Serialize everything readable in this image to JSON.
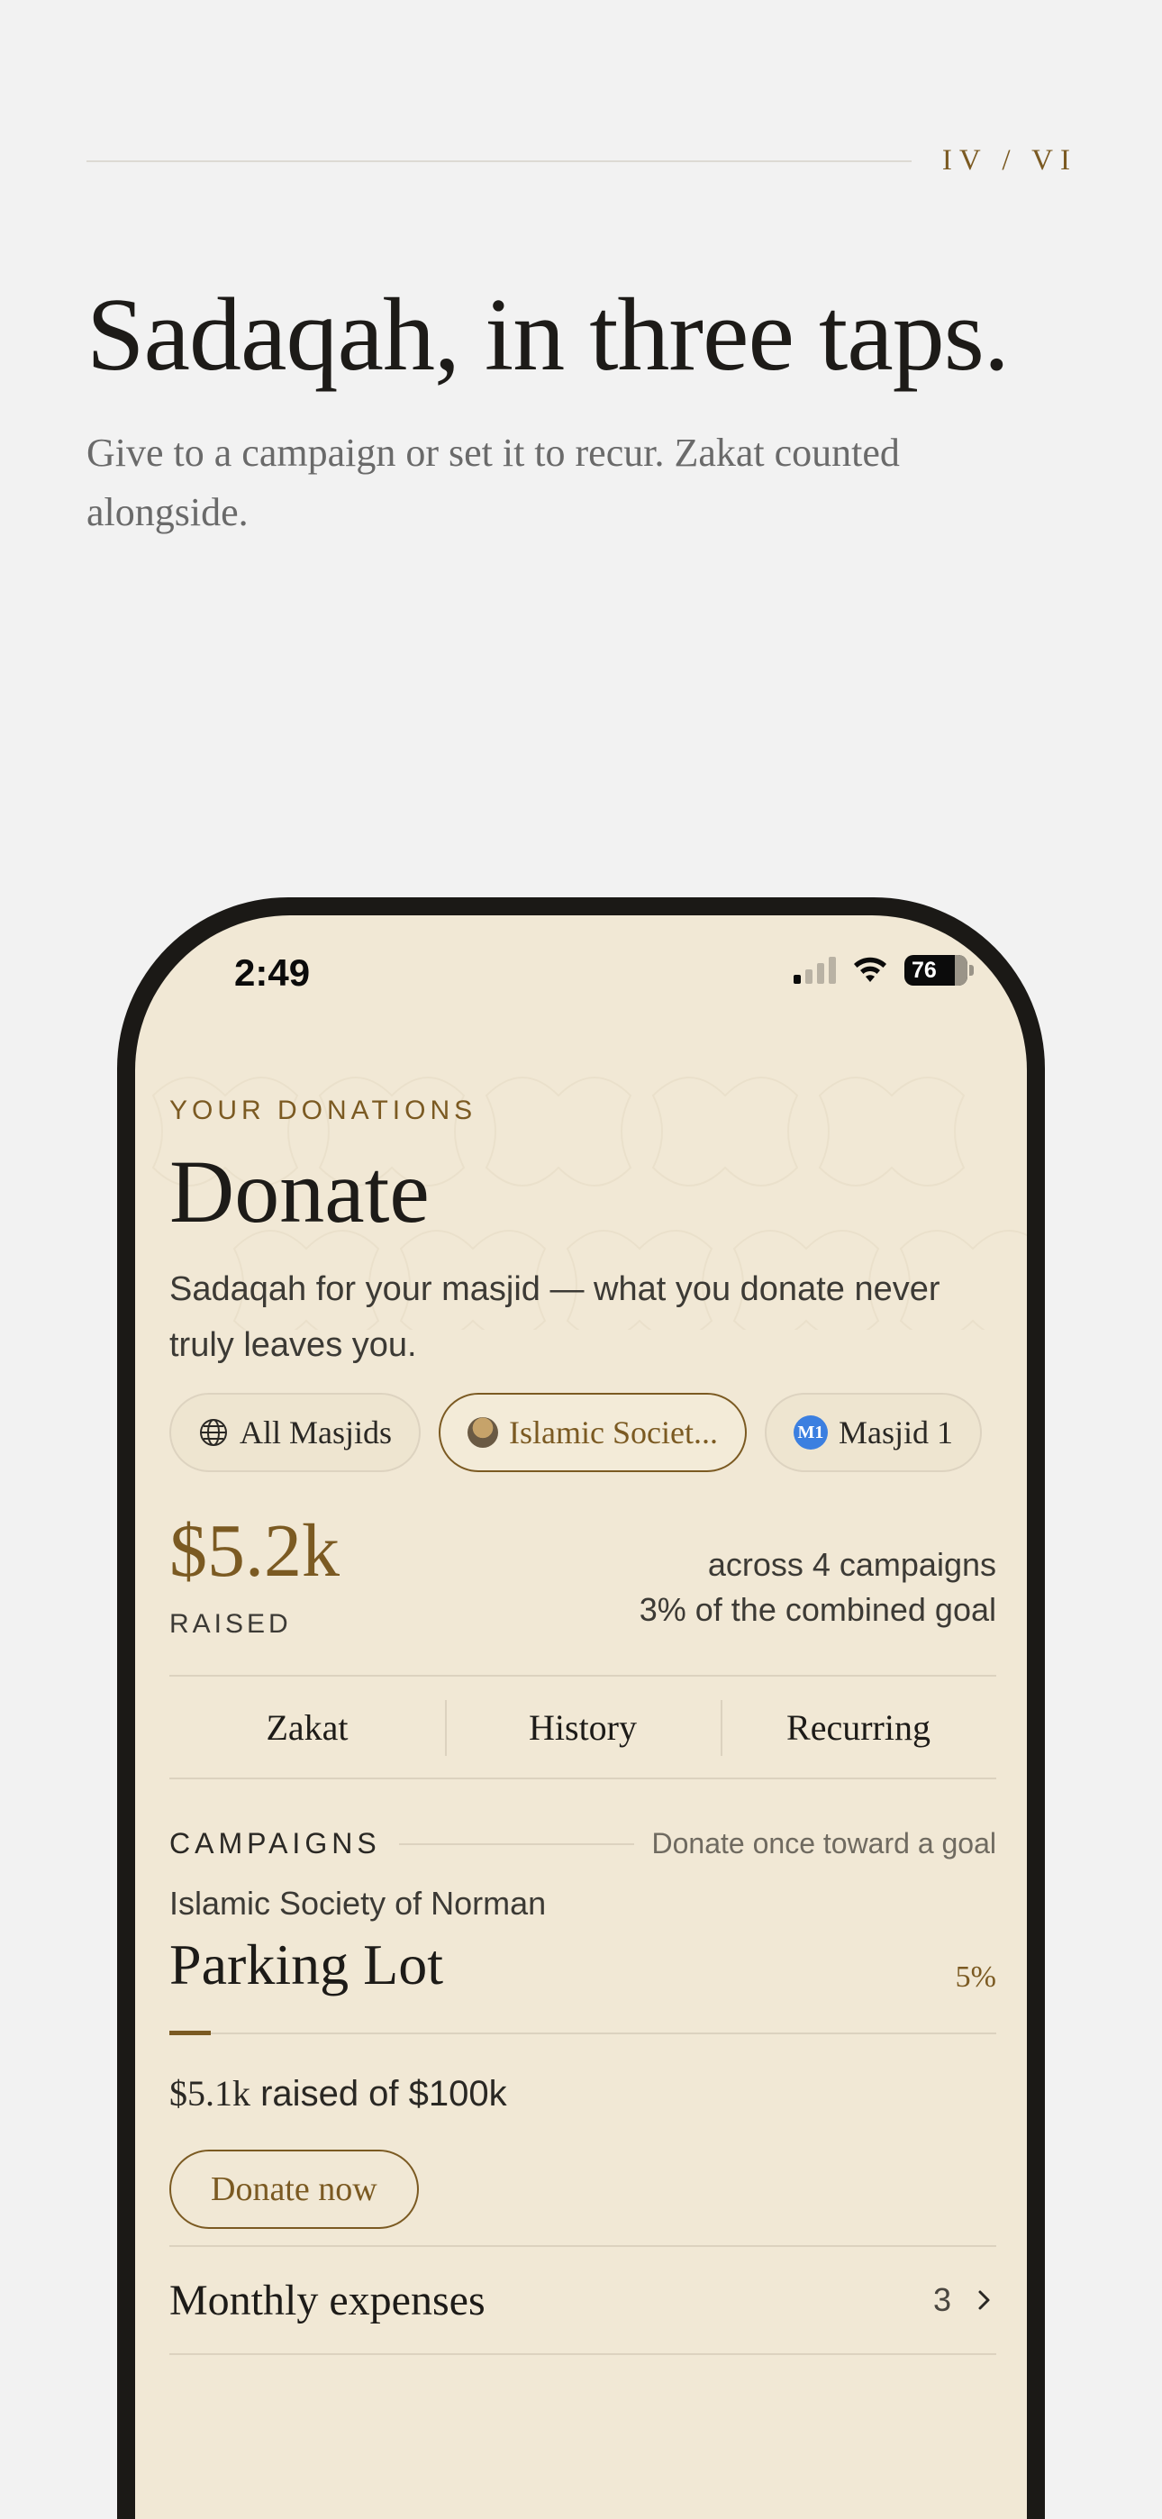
{
  "page": {
    "counter": "IV / VI",
    "headline": "Sadaqah, in three taps.",
    "subhead": "Give to a campaign or set it to recur. Zakat counted alongside."
  },
  "status_bar": {
    "time": "2:49",
    "battery": "76"
  },
  "screen": {
    "eyebrow": "YOUR DONATIONS",
    "title": "Donate",
    "intro": "Sadaqah for your masjid — what you donate never truly leaves you.",
    "chips": [
      {
        "label": "All Masjids",
        "icon": "globe-icon"
      },
      {
        "label": "Islamic Societ...",
        "icon": "masjid-avatar"
      },
      {
        "label": "Masjid 1",
        "icon": "m1-avatar",
        "avatar_text": "M1"
      }
    ],
    "raised": {
      "amount": "$5.2k",
      "label": "RAISED",
      "campaigns": "across 4 campaigns",
      "goal": "3% of the combined goal"
    },
    "tabs": [
      "Zakat",
      "History",
      "Recurring"
    ],
    "campaigns_section": {
      "label": "CAMPAIGNS",
      "hint": "Donate once toward a goal"
    },
    "campaign": {
      "org": "Islamic Society of Norman",
      "title": "Parking Lot",
      "percent_label": "5%",
      "progress": 0.05,
      "raised_amount": "$5.1k",
      "raised_rest": " raised of $100k",
      "button": "Donate now"
    },
    "list_row": {
      "name": "Monthly expenses",
      "count": "3"
    }
  },
  "colors": {
    "accent": "#7b5a22",
    "screen_bg": "#f1e8d5",
    "page_bg": "#f2f2f2",
    "frame": "#1b1916"
  }
}
